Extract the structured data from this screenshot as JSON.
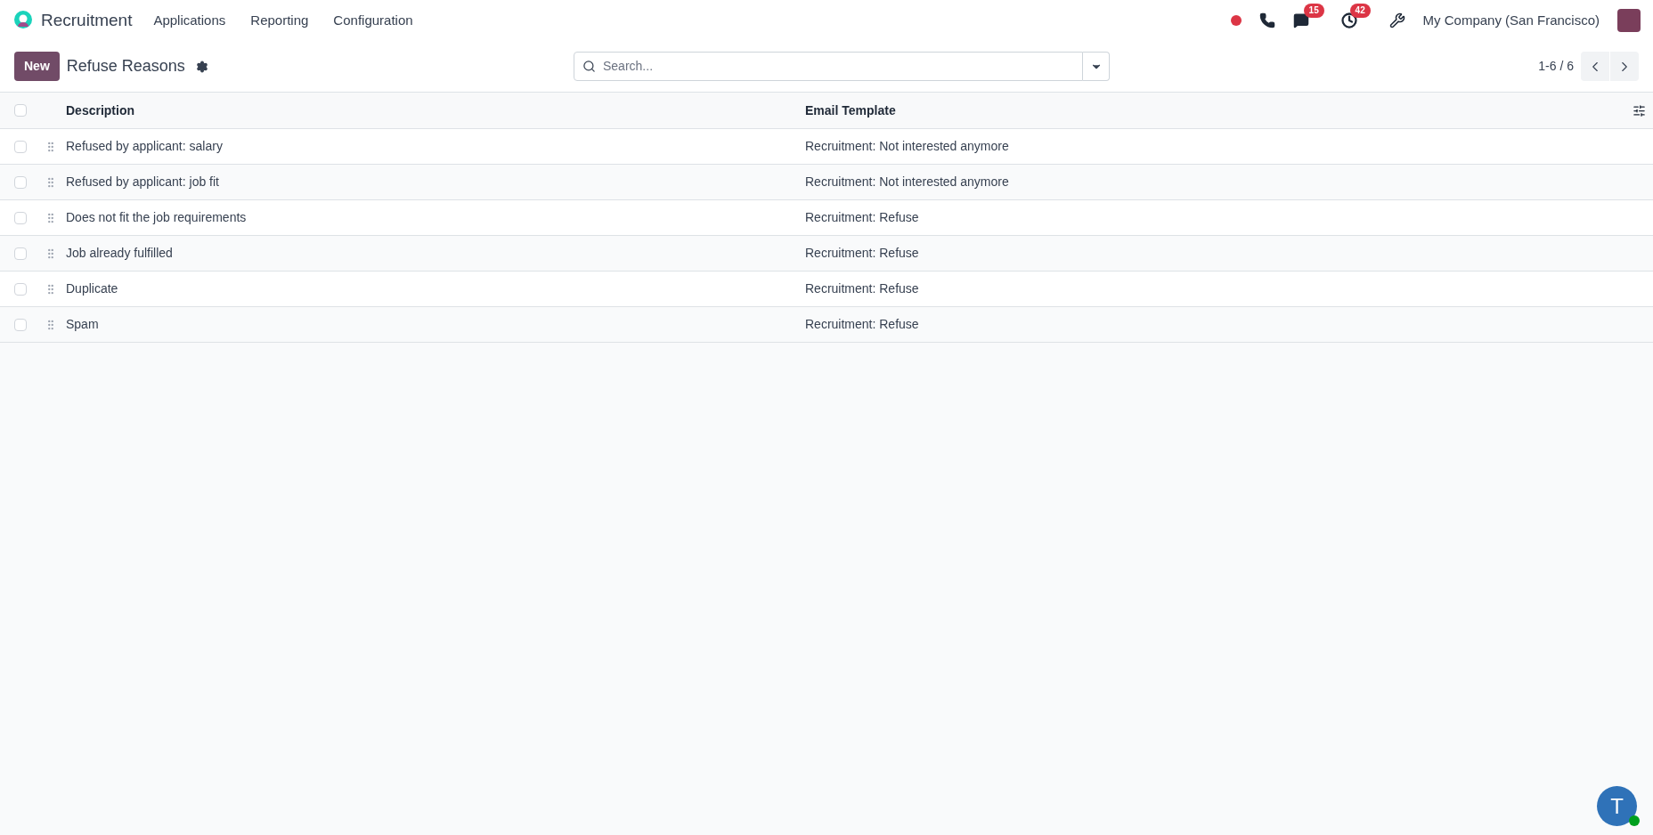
{
  "navbar": {
    "app_name": "Recruitment",
    "menu": [
      "Applications",
      "Reporting",
      "Configuration"
    ],
    "messages_badge": "15",
    "activities_badge": "42",
    "company": "My Company (San Francisco)"
  },
  "control_panel": {
    "new_button": "New",
    "title": "Refuse Reasons",
    "search": {
      "placeholder": "Search..."
    },
    "pager": "1-6 / 6"
  },
  "table": {
    "select_all_checked": false,
    "columns": [
      "Description",
      "Email Template"
    ],
    "rows": [
      {
        "description": "Refused by applicant: salary",
        "email_template": "Recruitment: Not interested anymore",
        "checked": false
      },
      {
        "description": "Refused by applicant: job fit",
        "email_template": "Recruitment: Not interested anymore",
        "checked": false
      },
      {
        "description": "Does not fit the job requirements",
        "email_template": "Recruitment: Refuse",
        "checked": false
      },
      {
        "description": "Job already fulfilled",
        "email_template": "Recruitment: Refuse",
        "checked": false
      },
      {
        "description": "Duplicate",
        "email_template": "Recruitment: Refuse",
        "checked": false
      },
      {
        "description": "Spam",
        "email_template": "Recruitment: Refuse",
        "checked": false
      }
    ]
  },
  "chat_bubble": {
    "initial": "T",
    "online": true
  }
}
